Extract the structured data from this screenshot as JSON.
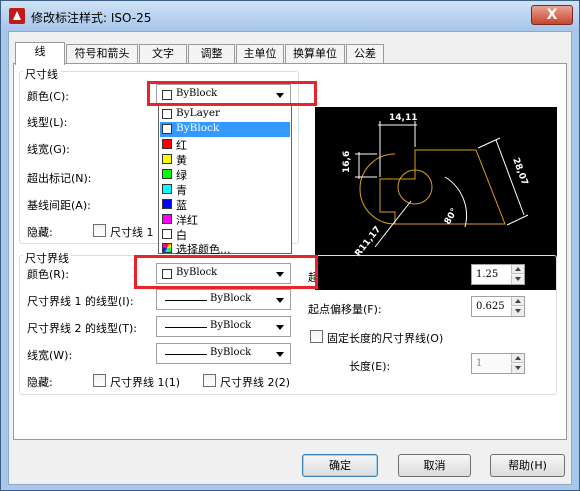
{
  "window": {
    "title": "修改标注样式: ISO-25",
    "close_label": "X"
  },
  "tabs": [
    {
      "label": "线",
      "active": true
    },
    {
      "label": "符号和箭头"
    },
    {
      "label": "文字"
    },
    {
      "label": "调整"
    },
    {
      "label": "主单位"
    },
    {
      "label": "换算单位"
    },
    {
      "label": "公差"
    }
  ],
  "dim_lines": {
    "group_title": "尺寸线",
    "color_label": "颜色(C):",
    "color_value": "ByBlock",
    "linetype_label": "线型(L):",
    "lineweight_label": "线宽(G):",
    "extend_ticks_label": "超出标记(N):",
    "baseline_spacing_label": "基线间距(A):",
    "suppress_label": "隐藏:",
    "suppress_dim1_label": "尺寸线 1"
  },
  "color_dropdown": {
    "items": [
      {
        "label": "ByLayer",
        "color": "#ffffff"
      },
      {
        "label": "ByBlock",
        "color": "#ffffff",
        "selected": true
      },
      {
        "label": "红",
        "color": "#ff0000"
      },
      {
        "label": "黄",
        "color": "#ffff00"
      },
      {
        "label": "绿",
        "color": "#00ff00"
      },
      {
        "label": "青",
        "color": "#00ffff"
      },
      {
        "label": "蓝",
        "color": "#0000ff"
      },
      {
        "label": "洋红",
        "color": "#ff00ff"
      },
      {
        "label": "白",
        "color": "#ffffff"
      },
      {
        "label": "选择颜色...",
        "color": "multicolor"
      }
    ]
  },
  "preview": {
    "dim_top": "14,11",
    "dim_left": "16,6",
    "dim_right": "28,07",
    "dim_angle": "80°",
    "dim_radius": "R11,17"
  },
  "ext_lines": {
    "group_title": "尺寸界线",
    "color_label": "颜色(R):",
    "color_value": "ByBlock",
    "linetype1_label": "尺寸界线 1 的线型(I):",
    "linetype1_value": "ByBlock",
    "linetype2_label": "尺寸界线 2 的线型(T):",
    "linetype2_value": "ByBlock",
    "lineweight_label": "线宽(W):",
    "lineweight_value": "ByBlock",
    "suppress_label": "隐藏:",
    "suppress_ext1_label": "尺寸界线 1(1)",
    "suppress_ext2_label": "尺寸界线 2(2)",
    "extend_beyond_label": "超出尺寸线(X):",
    "extend_beyond_value": "1.25",
    "offset_label": "起点偏移量(F):",
    "offset_value": "0.625",
    "fixed_length_label": "固定长度的尺寸界线(O)",
    "length_label": "长度(E):",
    "length_value": "1"
  },
  "buttons": {
    "ok": "确定",
    "cancel": "取消",
    "help": "帮助(H)"
  },
  "colors": {
    "highlight": "#e8232c",
    "preview_geometry": "#d9a020",
    "selection": "#3399ff"
  }
}
